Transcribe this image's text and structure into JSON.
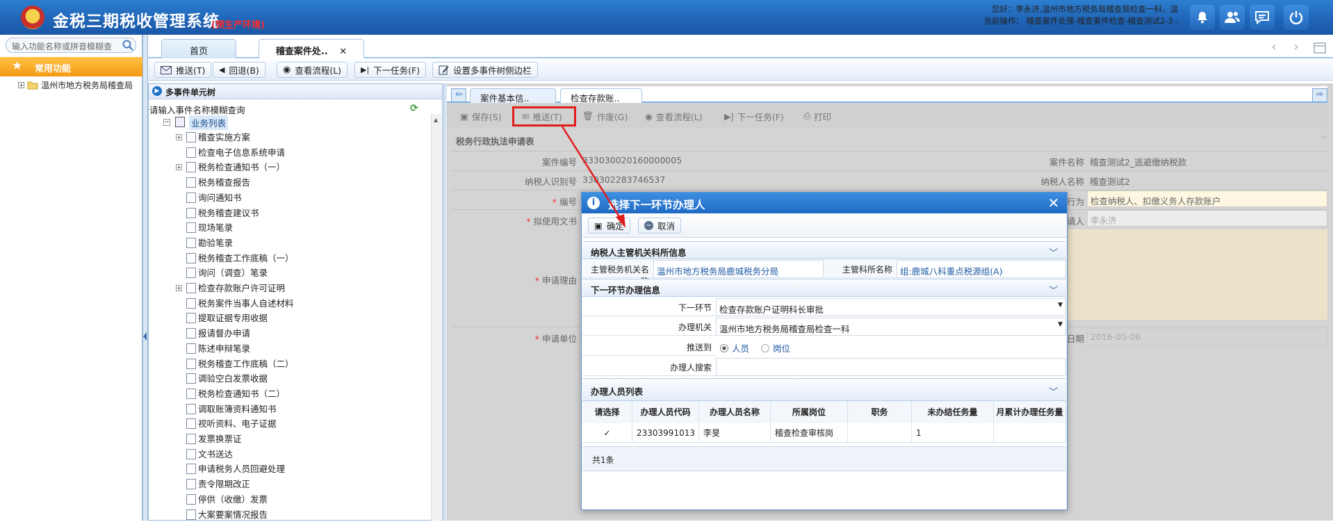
{
  "header": {
    "app_title": "金税三期税收管理系统",
    "env_label": "(预生产环境)",
    "user_line": "您好：李永济,温州市地方税务局稽查局检查一科，温",
    "operation_line": "当前操作： 稽查案件处理-稽查案件检查-稽查测试2-3..",
    "icons": [
      "bell-icon",
      "users-icon",
      "chat-icon",
      "power-icon"
    ]
  },
  "sidebar": {
    "search_placeholder": "输入功能名称或拼音模糊查",
    "common_label": "常用功能",
    "tree_root": "温州市地方税务局稽查局"
  },
  "main_tabs": [
    {
      "label": "首页"
    },
    {
      "label": "稽查案件处..",
      "close": "✕"
    }
  ],
  "toolbar": {
    "push": "推送(T)",
    "back": "回退(B)",
    "view_flow": "查看流程(L)",
    "next_task": "下一任务(F)",
    "set_sidebar": "设置多事件树侧边栏"
  },
  "tree": {
    "header": "多事件单元树",
    "query_label": "请输入事件名称模糊查询",
    "list_label": "业务列表",
    "items": [
      "稽查实施方案",
      "检查电子信息系统申请",
      "税务检查通知书（一）",
      "税务稽查报告",
      "询问通知书",
      "税务稽查建议书",
      "现场笔录",
      "勘验笔录",
      "税务稽查工作底稿（一）",
      "询问（调查）笔录",
      "检查存款账户许可证明",
      "税务案件当事人自述材料",
      "提取证据专用收据",
      "报请督办申请",
      "陈述申辩笔录",
      "税务稽查工作底稿（二）",
      "调验空白发票收据",
      "税务检查通知书（二）",
      "调取账簿资料通知书",
      "视听资料、电子证据",
      "发票换票证",
      "文书送达",
      "申请税务人员回避处理",
      "责令限期改正",
      "停供（收缴）发票",
      "大案要案情况报告"
    ]
  },
  "sub_tabs": [
    {
      "label": "案件基本信.."
    },
    {
      "label": "检查存款账..",
      "close": "✕"
    }
  ],
  "toolbar2": {
    "save": "保存(S)",
    "push": "推送(T)",
    "void": "作废(G)",
    "view_flow": "查看流程(L)",
    "next_task": "下一任务(F)",
    "print": "打印"
  },
  "form": {
    "title": "税务行政执法申请表",
    "case_no_label": "案件编号",
    "case_no": "333030020160000005",
    "case_name_label": "案件名称",
    "case_name": "稽查测试2_逃避缴纳税款",
    "taxpayer_id_label": "纳税人识别号",
    "taxpayer_id": "330302283746537",
    "taxpayer_name_label": "纳税人名称",
    "taxpayer_name": "稽查测试2",
    "number_label": "编号",
    "exec_label": "执法行为",
    "exec_value": "检查纳税人、扣缴义务人存款账户",
    "doc_label": "拟使用文书",
    "applicant_label": "申请人",
    "applicant_value": "李永济",
    "reason_label": "申请理由",
    "unit_label": "申请单位",
    "date_label": "申请日期",
    "date_value": "2016-05-06"
  },
  "dialog": {
    "title": "选择下一环节办理人",
    "confirm": "确定",
    "cancel": "取消",
    "section1": "纳税人主管机关科所信息",
    "org_label": "主管税务机关名称",
    "org_value": "温州市地方税务局鹿城税务分局",
    "dept_label": "主管科所名称",
    "dept_value": "组:鹿城八科重点税源组(A)",
    "section2": "下一环节办理信息",
    "next_step_label": "下一环节",
    "next_step_value": "检查存款账户证明科长审批",
    "agency_label": "办理机关",
    "agency_value": "温州市地方税务局稽查局检查一科",
    "push_to_label": "推送到",
    "radio_person": "人员",
    "radio_post": "岗位",
    "search_label": "办理人搜索",
    "section3": "办理人员列表",
    "columns": [
      "请选择",
      "办理人员代码",
      "办理人员名称",
      "所属岗位",
      "职务",
      "未办结任务量",
      "月累计办理任务量"
    ],
    "rows": [
      {
        "check": "✓",
        "code": "23303991013",
        "name": "李旻",
        "post": "稽查检查审核岗",
        "title": "",
        "pending": "1",
        "monthly": ""
      }
    ],
    "total": "共1条"
  }
}
